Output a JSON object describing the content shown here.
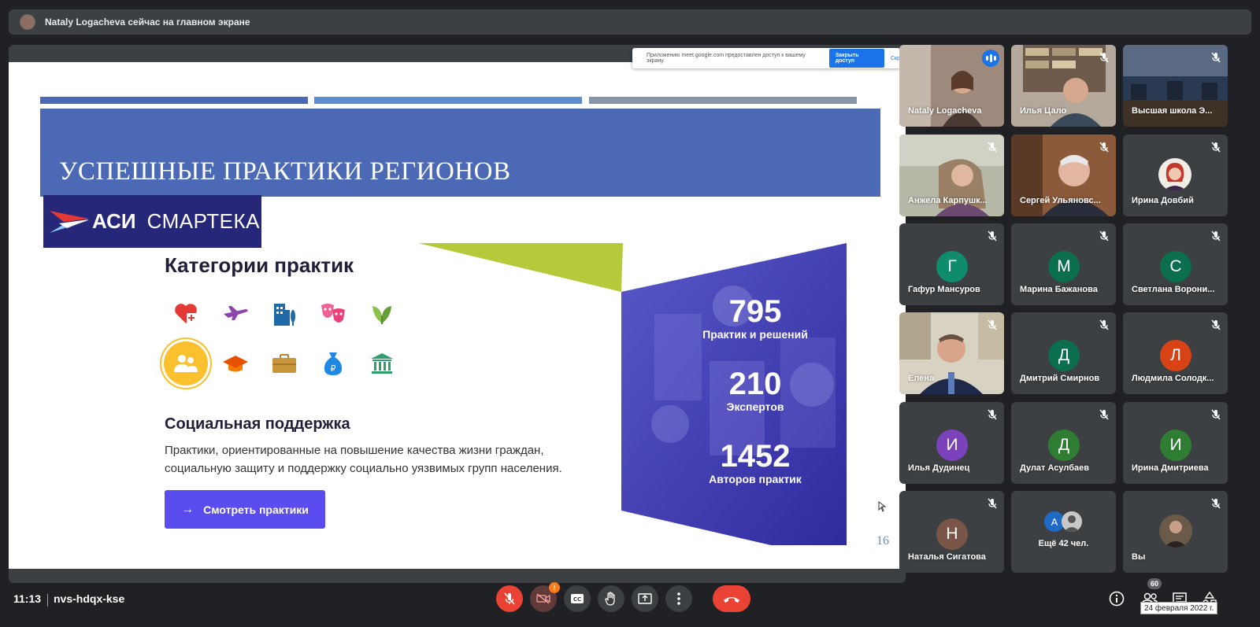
{
  "presenter_banner": {
    "text": "Nataly Logacheva сейчас на главном экране"
  },
  "share_notice": {
    "message": "Приложению meet.google.com предоставлен доступ к вашему экрану.",
    "stop_label": "Закрыть доступ",
    "hide_label": "Скр"
  },
  "slide": {
    "title": "УСПЕШНЫЕ ПРАКТИКИ РЕГИОНОВ",
    "logo_left": "АСИ",
    "logo_right": "СМАРТЕКА",
    "categories_title": "Категории практик",
    "selected_category": "Социальная поддержка",
    "description": "Практики, ориентированные на повышение качества жизни граждан, социальную защиту и поддержку социально уязвимых групп населения.",
    "cta_label": "Смотреть практики",
    "page_number": "16",
    "stats": [
      {
        "value": "795",
        "label": "Практик и решений"
      },
      {
        "value": "210",
        "label": "Экспертов"
      },
      {
        "value": "1452",
        "label": "Авторов практик"
      }
    ],
    "category_icons": [
      "heart-health-icon",
      "airplane-icon",
      "city-buildings-icon",
      "theater-masks-icon",
      "leaf-icon",
      "people-icon",
      "graduation-cap-icon",
      "briefcase-icon",
      "money-bag-icon",
      "museum-icon"
    ]
  },
  "participants": [
    {
      "name": "Nataly Logacheva",
      "type": "video",
      "speaking": true
    },
    {
      "name": "Илья Цало",
      "type": "video"
    },
    {
      "name": "Высшая школа Э...",
      "type": "video"
    },
    {
      "name": "Анжела Карпушк...",
      "type": "video"
    },
    {
      "name": "Сергей Ульяновс...",
      "type": "video"
    },
    {
      "name": "Ирина Довбий",
      "type": "photo"
    },
    {
      "name": "Гафур Мансуров",
      "type": "letter",
      "letter": "Г",
      "color": "#0f8c6c"
    },
    {
      "name": "Марина Бажанова",
      "type": "letter",
      "letter": "М",
      "color": "#0b6e4f"
    },
    {
      "name": "Светлана Ворони...",
      "type": "letter",
      "letter": "С",
      "color": "#0b6e4f"
    },
    {
      "name": "Елена",
      "type": "video"
    },
    {
      "name": "Дмитрий Смирнов",
      "type": "letter",
      "letter": "Д",
      "color": "#0b6e4f"
    },
    {
      "name": "Людмила Солодк...",
      "type": "letter",
      "letter": "Л",
      "color": "#d84315"
    },
    {
      "name": "Илья Дудинец",
      "type": "letter",
      "letter": "И",
      "color": "#7b42bc"
    },
    {
      "name": "Дулат Асулбаев",
      "type": "letter",
      "letter": "Д",
      "color": "#2e7d32"
    },
    {
      "name": "Ирина Дмитриева",
      "type": "letter",
      "letter": "И",
      "color": "#2e7d32"
    },
    {
      "name": "Наталья Сигатова",
      "type": "letter",
      "letter": "Н",
      "color": "#795548"
    },
    {
      "name": "Ещё 42 чел.",
      "type": "more",
      "letter": "А"
    },
    {
      "name": "Вы",
      "type": "self"
    }
  ],
  "bottom": {
    "time": "11:13",
    "meeting_code": "nvs-hdqx-kse",
    "camera_alert": "!",
    "people_count": "60",
    "date_tooltip": "24 февраля 2022 г."
  },
  "colors": {
    "accent": "#1a73e8",
    "danger": "#ea4335",
    "slide_blue": "#4b69b5",
    "cta": "#5b4cf0"
  }
}
